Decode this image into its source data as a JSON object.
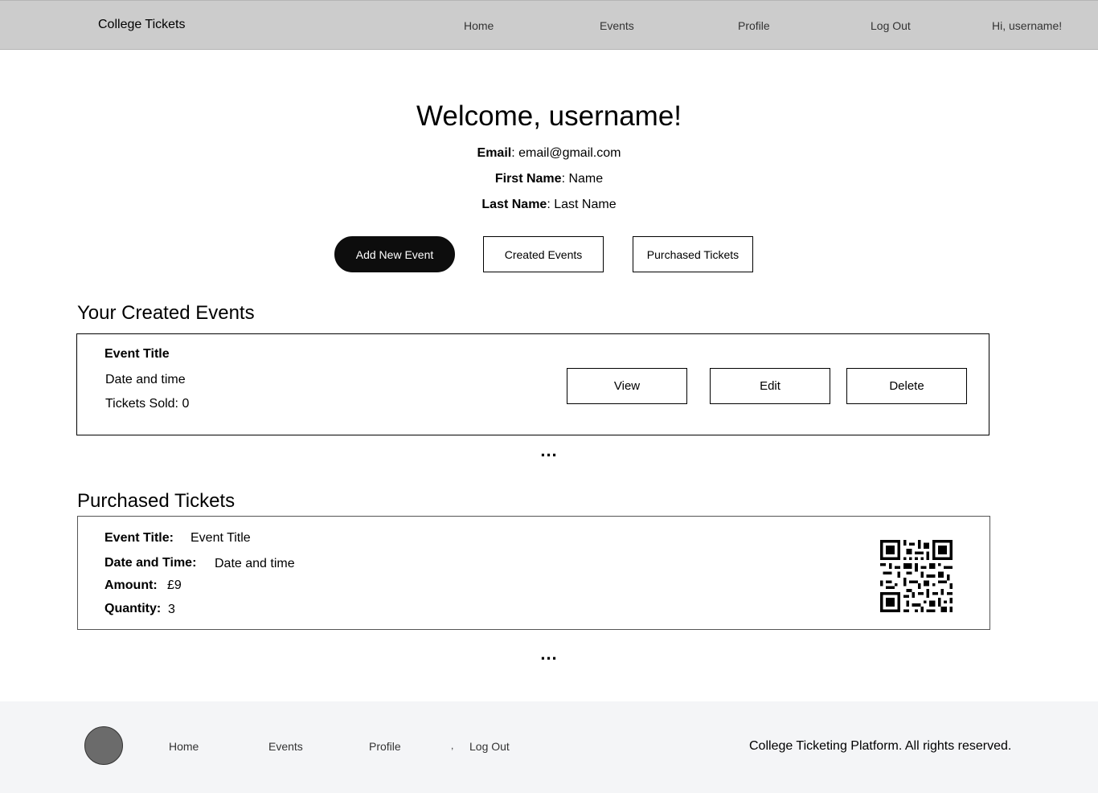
{
  "header": {
    "brand": "College Tickets",
    "nav": [
      "Home",
      "Events",
      "Profile",
      "Log Out"
    ],
    "greeting": "Hi, username!"
  },
  "profile": {
    "welcome": "Welcome, username!",
    "email_label": "Email",
    "email_value": ": email@gmail.com",
    "first_name_label": "First Name",
    "first_name_value": ": Name",
    "last_name_label": "Last Name",
    "last_name_value": ": Last Name"
  },
  "actions": {
    "add_new_event": "Add New Event",
    "created_events": "Created Events",
    "purchased_tickets": "Purchased Tickets"
  },
  "created_events": {
    "title": "Your Created Events",
    "items": [
      {
        "event_title": "Event Title",
        "date_time": "Date and time",
        "tickets_sold": "Tickets Sold: 0",
        "view_label": "View",
        "edit_label": "Edit",
        "delete_label": "Delete"
      }
    ],
    "more": "..."
  },
  "purchased_tickets": {
    "title": "Purchased Tickets",
    "items": [
      {
        "event_title_label": "Event Title:",
        "event_title_value": "Event Title",
        "date_time_label": "Date and Time:",
        "date_time_value": "Date and time",
        "amount_label": "Amount:",
        "amount_value": "£9",
        "quantity_label": "Quantity:",
        "quantity_value": "3"
      }
    ],
    "more": "..."
  },
  "footer": {
    "nav": [
      "Home",
      "Events",
      "Profile",
      "Log Out"
    ],
    "separator": ",",
    "copyright": "College Ticketing Platform. All rights reserved."
  }
}
